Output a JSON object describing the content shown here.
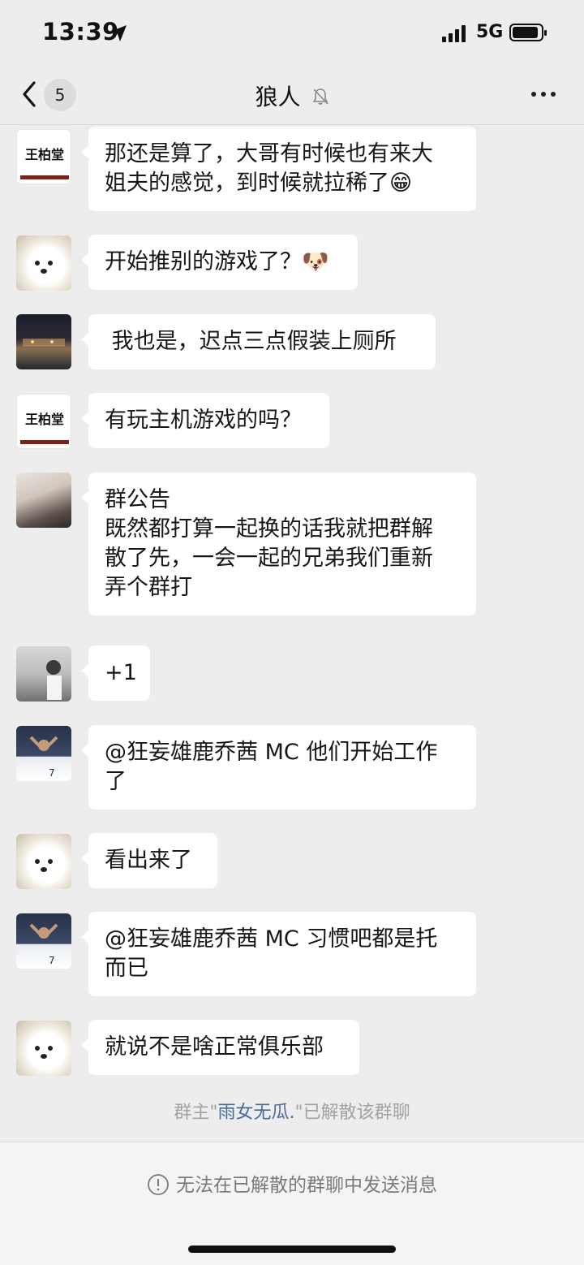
{
  "status_bar": {
    "time": "13:39",
    "network": "5G"
  },
  "nav": {
    "unread_count": "5",
    "title": "狼人"
  },
  "messages": [
    {
      "text": "那还是算了，大哥有时候也有来大\n姐夫的感觉，到时候就拉稀了😁",
      "avatar": "seal-avatar",
      "avatar_text": "王柏堂"
    },
    {
      "text": "开始推别的游戏了？🐶",
      "avatar": "dog-avatar"
    },
    {
      "text": " 我也是，迟点三点假装上厕所",
      "avatar": "night-scene-avatar"
    },
    {
      "text": "有玩主机游戏的吗？",
      "avatar": "seal-avatar",
      "avatar_text": "王柏堂"
    },
    {
      "text": "群公告\n既然都打算一起换的话我就把群解\n散了先，一会一起的兄弟我们重新\n弄个群打",
      "avatar": "person-avatar"
    },
    {
      "text": "+1",
      "avatar": "girl-avatar"
    },
    {
      "text": "@狂妄雄鹿乔茜 MC 他们开始工作\n了",
      "avatar": "soccer-avatar"
    },
    {
      "text": "看出来了",
      "avatar": "dog-avatar"
    },
    {
      "text": "@狂妄雄鹿乔茜 MC 习惯吧都是托\n而已",
      "avatar": "soccer-avatar"
    },
    {
      "text": "就说不是啥正常俱乐部",
      "avatar": "dog-avatar"
    }
  ],
  "system_note": {
    "prefix": "群主\"",
    "owner": "雨女无瓜.",
    "suffix": "\"已解散该群聊"
  },
  "footer": {
    "notice": "无法在已解散的群聊中发送消息"
  }
}
